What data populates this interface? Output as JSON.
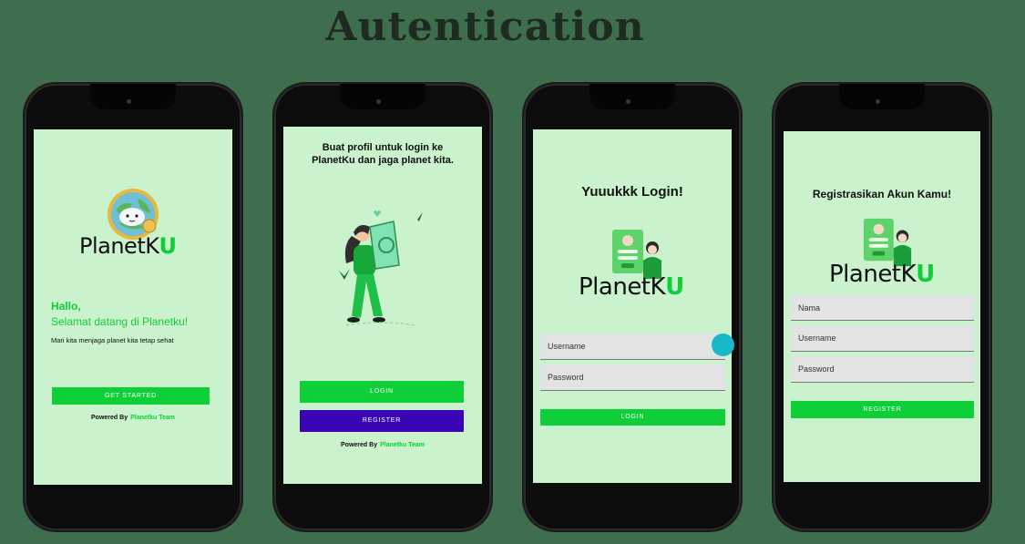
{
  "header": {
    "title": "Autentication"
  },
  "colors": {
    "background": "#3f6e4e",
    "screen": "#c9f2cd",
    "accent_green": "#0ecf38",
    "register_purple": "#3a05b5"
  },
  "screens": [
    {
      "logo": {
        "text_main": "PlanetK",
        "text_accent": "U"
      },
      "greeting": "Hallo,",
      "welcome": "Selamat datang di Planetku!",
      "subtitle": "Mari kita menjaga planet kita tetap sehat",
      "button": "GET STARTED",
      "powered_by": "Powered By",
      "team": "Planetku Team"
    },
    {
      "heading": "Buat profil untuk login ke PlanetKu dan jaga planet kita.",
      "login_button": "LOGIN",
      "register_button": "REGISTER",
      "powered_by": "Powered By",
      "team": "Planetku Team"
    },
    {
      "heading": "Yuuukkk Login!",
      "logo": {
        "text_main": "PlanetK",
        "text_accent": "U"
      },
      "username_placeholder": "Username",
      "password_placeholder": "Password",
      "button": "LOGIN"
    },
    {
      "heading": "Registrasikan Akun Kamu!",
      "logo": {
        "text_main": "PlanetK",
        "text_accent": "U"
      },
      "name_placeholder": "Nama",
      "username_placeholder": "Username",
      "password_placeholder": "Password",
      "button": "REGISTER"
    }
  ]
}
